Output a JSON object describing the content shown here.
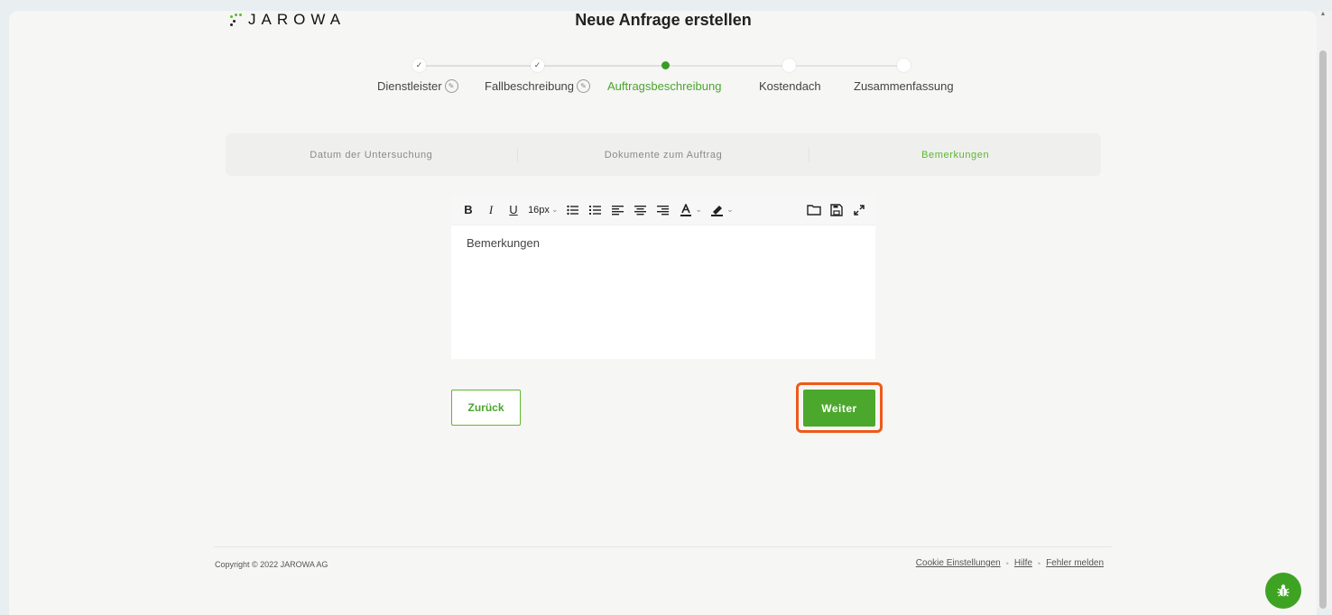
{
  "app": {
    "logo_text": "JAROWA",
    "page_title": "Neue Anfrage erstellen"
  },
  "stepper": {
    "steps": [
      {
        "label": "Dienstleister",
        "state": "done",
        "editable": true
      },
      {
        "label": "Fallbeschreibung",
        "state": "done",
        "editable": true
      },
      {
        "label": "Auftragsbeschreibung",
        "state": "active",
        "editable": false
      },
      {
        "label": "Kostendach",
        "state": "pending",
        "editable": false
      },
      {
        "label": "Zusammenfassung",
        "state": "pending",
        "editable": false
      }
    ],
    "check_glyph": "✓",
    "edit_glyph": "✎"
  },
  "subtabs": {
    "items": [
      {
        "label": "Datum der Untersuchung",
        "active": false
      },
      {
        "label": "Dokumente zum Auftrag",
        "active": false
      },
      {
        "label": "Bemerkungen",
        "active": true
      }
    ]
  },
  "editor": {
    "toolbar": {
      "bold": "B",
      "italic": "I",
      "underline": "U",
      "font_size": "16px",
      "caret": "⌄"
    },
    "content": "Bemerkungen"
  },
  "buttons": {
    "back_label": "Zurück",
    "next_label": "Weiter"
  },
  "footer": {
    "copyright": "Copyright © 2022 JAROWA AG",
    "links": [
      "Cookie Einstellungen",
      "Hilfe",
      "Fehler melden"
    ],
    "separator": "•"
  },
  "colors": {
    "brand_green": "#4ba82d",
    "accent_green": "#5cb82e",
    "highlight_orange": "#ee5a18"
  }
}
